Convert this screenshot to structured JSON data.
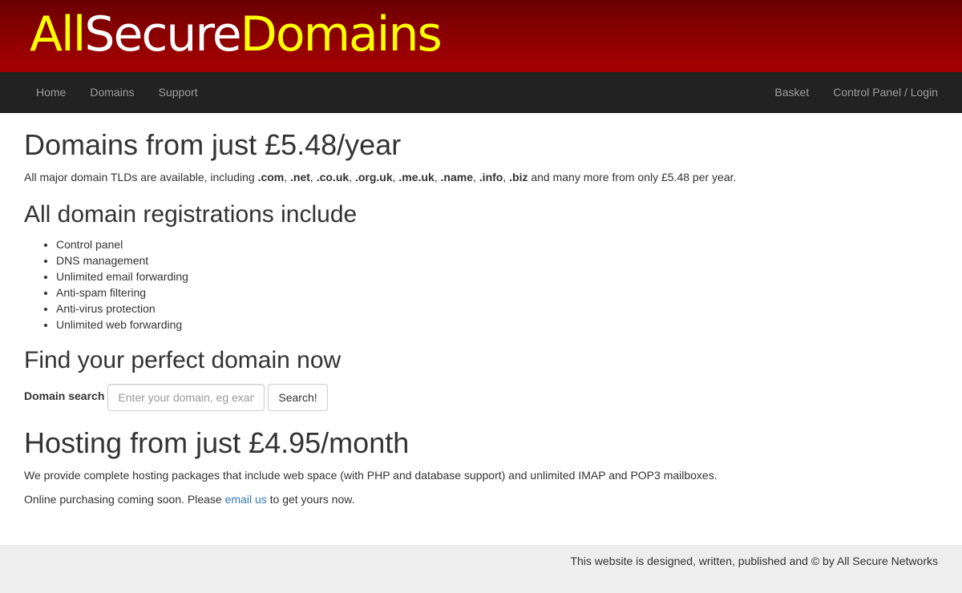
{
  "header": {
    "logo": {
      "part1": "All",
      "part2": "Secure",
      "part3": "Domains"
    }
  },
  "nav": {
    "left": [
      "Home",
      "Domains",
      "Support"
    ],
    "right": [
      "Basket",
      "Control Panel / Login"
    ]
  },
  "domains_section": {
    "title": "Domains from just £5.48/year",
    "intro_prefix": "All major domain TLDs are available, including",
    "tlds": [
      ".com",
      ".net",
      ".co.uk",
      ".org.uk",
      ".me.uk",
      ".name",
      ".info",
      ".biz"
    ],
    "intro_suffix": "and many more from only £5.48 per year."
  },
  "includes_section": {
    "title": "All domain registrations include",
    "items": [
      "Control panel",
      "DNS management",
      "Unlimited email forwarding",
      "Anti-spam filtering",
      "Anti-virus protection",
      "Unlimited web forwarding"
    ]
  },
  "search_section": {
    "title": "Find your perfect domain now",
    "label": "Domain search",
    "placeholder": "Enter your domain, eg example.com",
    "button_label": "Search!"
  },
  "hosting_section": {
    "title": "Hosting from just £4.95/month",
    "description": "We provide complete hosting packages that include web space (with PHP and database support) and unlimited IMAP and POP3 mailboxes.",
    "cta_prefix": "Online purchasing coming soon. Please",
    "cta_link": "email us",
    "cta_suffix": "to get yours now."
  },
  "footer": {
    "text": "This website is designed, written, published and © by All Secure Networks"
  },
  "colors": {
    "header_dark": "#6a0000",
    "header_light": "#a60000",
    "logo_yellow": "#ffff00",
    "logo_white": "#ffffff",
    "navbar_bg": "#222222",
    "nav_text": "#9d9d9d",
    "link": "#337ab7",
    "footer_bg": "#eeeeee"
  }
}
